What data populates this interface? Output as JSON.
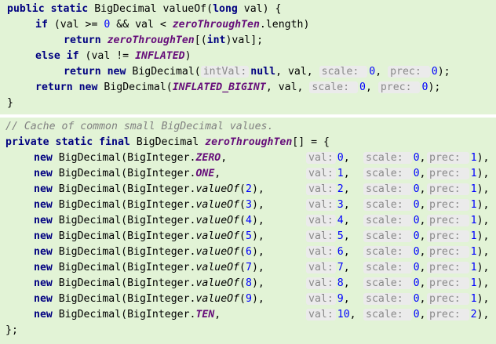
{
  "method": {
    "signature": {
      "kw_public": "public",
      "kw_static": "static",
      "type": "BigDecimal",
      "name": "valueOf",
      "kw_long": "long",
      "param": "val"
    },
    "if_line": {
      "kw_if": "if",
      "cond_a": "(val >= ",
      "zero": "0",
      "cond_b": " && val < ",
      "field": "zeroThroughTen",
      "cond_c": ".length)"
    },
    "return_cache": {
      "kw_return": "return",
      "field": "zeroThroughTen",
      "cast_open": "[(",
      "kw_int": "int",
      "cast_close": ")val];"
    },
    "else_line": {
      "kw_else": "else",
      "kw_if": "if",
      "cond_a": " (val != ",
      "const": "INFLATED",
      "cond_b": ")"
    },
    "return_new_1": {
      "kw_return": "return",
      "kw_new": "new",
      "ctor": "BigDecimal(",
      "hint_intval": "intVal:",
      "kw_null": "null",
      "after_null": ", val, ",
      "hint_scale": "scale:",
      "scale": "0",
      "sep": ", ",
      "hint_prec": "prec:",
      "prec": "0",
      "end": ");"
    },
    "return_new_2": {
      "kw_return": "return",
      "kw_new": "new",
      "ctor": "BigDecimal(",
      "const": "INFLATED_BIGINT",
      "after_const": ", val, ",
      "hint_scale": "scale:",
      "scale": "0",
      "sep": ", ",
      "hint_prec": "prec:",
      "prec": "0",
      "end": ");"
    },
    "close_brace": "}"
  },
  "cache": {
    "comment": "// Cache of common small BigDecimal values.",
    "decl": {
      "kw_private": "private",
      "kw_static": "static",
      "kw_final": "final",
      "type": "BigDecimal",
      "field": "zeroThroughTen",
      "tail": "[] = {"
    },
    "rows": [
      {
        "arg": "ZERO",
        "arg_kind": "const",
        "val": "0",
        "scale": "0",
        "prec": "1"
      },
      {
        "arg": "ONE",
        "arg_kind": "const",
        "val": "1",
        "scale": "0",
        "prec": "1"
      },
      {
        "arg": "valueOf",
        "arg_kind": "call",
        "call_arg": "2",
        "val": "2",
        "scale": "0",
        "prec": "1"
      },
      {
        "arg": "valueOf",
        "arg_kind": "call",
        "call_arg": "3",
        "val": "3",
        "scale": "0",
        "prec": "1"
      },
      {
        "arg": "valueOf",
        "arg_kind": "call",
        "call_arg": "4",
        "val": "4",
        "scale": "0",
        "prec": "1"
      },
      {
        "arg": "valueOf",
        "arg_kind": "call",
        "call_arg": "5",
        "val": "5",
        "scale": "0",
        "prec": "1"
      },
      {
        "arg": "valueOf",
        "arg_kind": "call",
        "call_arg": "6",
        "val": "6",
        "scale": "0",
        "prec": "1"
      },
      {
        "arg": "valueOf",
        "arg_kind": "call",
        "call_arg": "7",
        "val": "7",
        "scale": "0",
        "prec": "1"
      },
      {
        "arg": "valueOf",
        "arg_kind": "call",
        "call_arg": "8",
        "val": "8",
        "scale": "0",
        "prec": "1"
      },
      {
        "arg": "valueOf",
        "arg_kind": "call",
        "call_arg": "9",
        "val": "9",
        "scale": "0",
        "prec": "1"
      },
      {
        "arg": "TEN",
        "arg_kind": "const",
        "val": "10",
        "scale": "0",
        "prec": "2"
      }
    ],
    "row_parts": {
      "kw_new": "new",
      "ctor": "BigDecimal(BigInteger.",
      "hint_val": "val:",
      "hint_scale": "scale:",
      "hint_prec": "prec:"
    },
    "close": "};"
  },
  "colors": {
    "block_bg": "#e2f3d6",
    "keyword": "#000080",
    "number": "#0000ff",
    "static_field": "#660e7a",
    "comment": "#808080",
    "hint_bg": "#ebebeb",
    "hint_text": "#8a8a8a"
  }
}
